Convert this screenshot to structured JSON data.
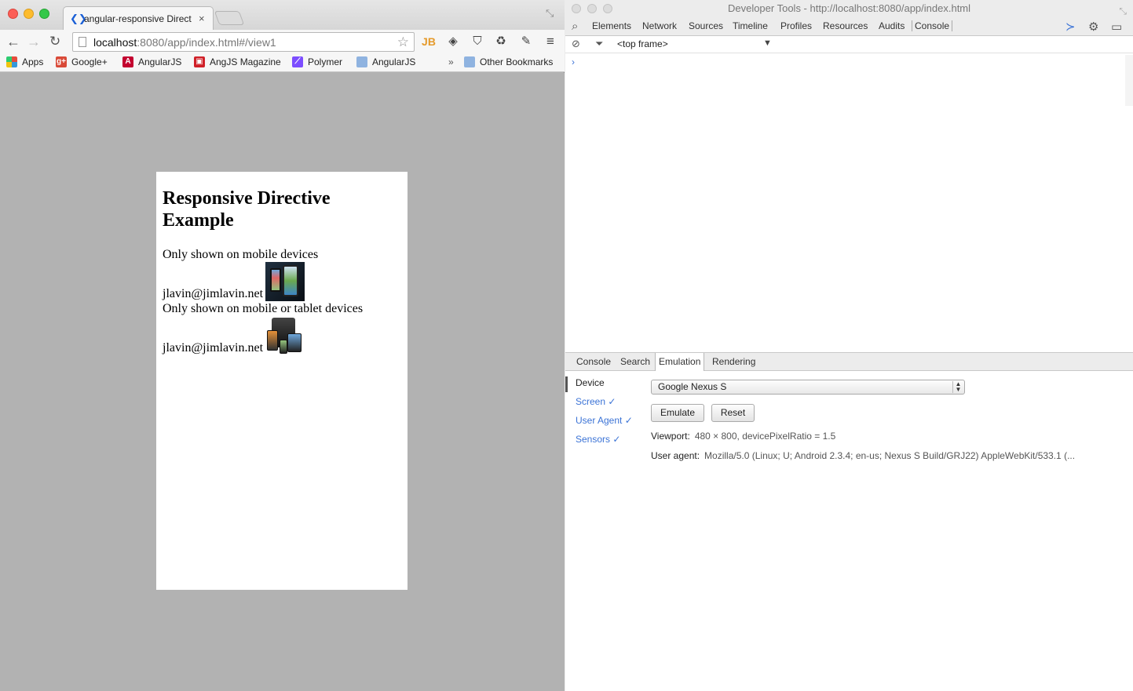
{
  "browser": {
    "tab_title": "angular-responsive Direct",
    "url_host": "localhost",
    "url_rest": ":8080/app/index.html#/view1",
    "bookmarks": [
      {
        "label": "Apps"
      },
      {
        "label": "Google+"
      },
      {
        "label": "AngularJS"
      },
      {
        "label": "AngJS Magazine"
      },
      {
        "label": "Polymer"
      },
      {
        "label": "AngularJS"
      },
      {
        "label": "Other Bookmarks"
      }
    ],
    "overflow": "»"
  },
  "page": {
    "heading": "Responsive Directive Example",
    "mobile_text": "Only shown on mobile devices",
    "email1": "jlavin@jimlavin.net",
    "tablet_text": "Only shown on mobile or tablet devices",
    "email2": "jlavin@jimlavin.net"
  },
  "devtools": {
    "title": "Developer Tools - http://localhost:8080/app/index.html",
    "tabs": [
      "Elements",
      "Network",
      "Sources",
      "Timeline",
      "Profiles",
      "Resources",
      "Audits",
      "Console"
    ],
    "frame": "<top frame>",
    "prompt": "›",
    "drawer_tabs": [
      "Console",
      "Search",
      "Emulation",
      "Rendering"
    ],
    "emulation_sections": [
      "Device",
      "Screen ✓",
      "User Agent ✓",
      "Sensors ✓"
    ],
    "device_value": "Google Nexus S",
    "emulate_label": "Emulate",
    "reset_label": "Reset",
    "viewport_label": "Viewport:",
    "viewport_value": "480 × 800, devicePixelRatio = 1.5",
    "ua_label": "User agent:",
    "ua_value": "Mozilla/5.0 (Linux; U; Android 2.3.4; en-us; Nexus S Build/GRJ22) AppleWebKit/533.1 (..."
  }
}
